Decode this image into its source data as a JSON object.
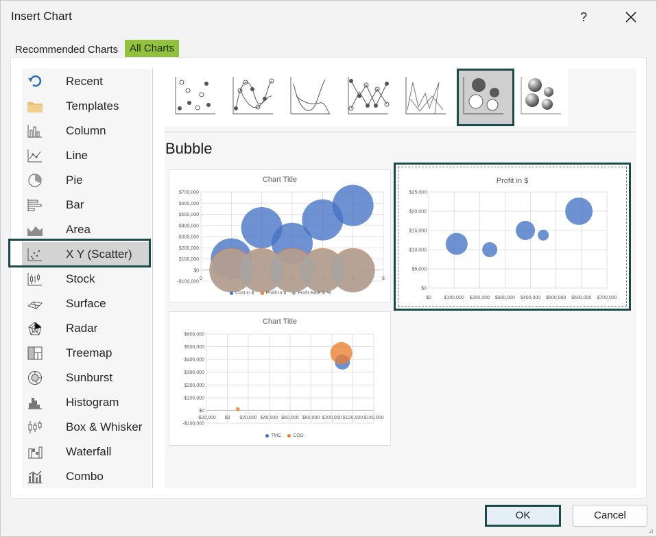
{
  "dialog": {
    "title": "Insert Chart",
    "help_label": "?"
  },
  "tabs": [
    {
      "label": "Recommended Charts",
      "active": false
    },
    {
      "label": "All Charts",
      "active": true,
      "color": "#92c13f"
    }
  ],
  "categories": [
    {
      "label": "Recent",
      "icon": "recent-icon"
    },
    {
      "label": "Templates",
      "icon": "folder-icon"
    },
    {
      "label": "Column",
      "icon": "column-chart-icon"
    },
    {
      "label": "Line",
      "icon": "line-chart-icon"
    },
    {
      "label": "Pie",
      "icon": "pie-chart-icon"
    },
    {
      "label": "Bar",
      "icon": "bar-chart-icon"
    },
    {
      "label": "Area",
      "icon": "area-chart-icon"
    },
    {
      "label": "X Y (Scatter)",
      "icon": "scatter-chart-icon",
      "selected": true
    },
    {
      "label": "Stock",
      "icon": "stock-chart-icon"
    },
    {
      "label": "Surface",
      "icon": "surface-chart-icon"
    },
    {
      "label": "Radar",
      "icon": "radar-chart-icon"
    },
    {
      "label": "Treemap",
      "icon": "treemap-chart-icon"
    },
    {
      "label": "Sunburst",
      "icon": "sunburst-chart-icon"
    },
    {
      "label": "Histogram",
      "icon": "histogram-chart-icon"
    },
    {
      "label": "Box & Whisker",
      "icon": "box-whisker-chart-icon"
    },
    {
      "label": "Waterfall",
      "icon": "waterfall-chart-icon"
    },
    {
      "label": "Combo",
      "icon": "combo-chart-icon"
    }
  ],
  "subtypes": [
    {
      "name": "scatter",
      "icon": "scatter-icon"
    },
    {
      "name": "scatter-smooth-lines-markers",
      "icon": "scatter-smooth-markers-icon"
    },
    {
      "name": "scatter-smooth-lines",
      "icon": "scatter-smooth-icon"
    },
    {
      "name": "scatter-straight-lines-markers",
      "icon": "scatter-straight-markers-icon"
    },
    {
      "name": "scatter-straight-lines",
      "icon": "scatter-straight-icon"
    },
    {
      "name": "bubble",
      "icon": "bubble-icon",
      "selected": true
    },
    {
      "name": "3d-bubble",
      "icon": "bubble-3d-icon"
    }
  ],
  "section_title": "Bubble",
  "chart_data": [
    {
      "type": "scatter",
      "variant": "bubble",
      "title": "Chart Title",
      "x": [
        1,
        2,
        3,
        4,
        5
      ],
      "xlim": [
        0,
        6
      ],
      "ylim": [
        -100000,
        700000
      ],
      "y_ticks": [
        "$700,000",
        "$600,000",
        "$500,000",
        "$400,000",
        "$300,000",
        "$200,000",
        "$100,000",
        "$0",
        "-$100,000"
      ],
      "x_ticks": [
        "0",
        "1",
        "2",
        "3",
        "4",
        "5",
        "6"
      ],
      "series": [
        {
          "name": "Cost in $",
          "color": "#4472c4",
          "values": [
            100000,
            380000,
            240000,
            450000,
            580000
          ],
          "sizes": [
            30,
            30,
            30,
            30,
            30
          ]
        },
        {
          "name": "Profit in $",
          "color": "#ed7d31",
          "values": [
            0,
            0,
            0,
            0,
            0
          ],
          "sizes": [
            32,
            32,
            32,
            32,
            32
          ]
        },
        {
          "name": "Profit Rate in %",
          "color": "#a5a5a5",
          "values": [
            -5000,
            -5000,
            -5000,
            -5000,
            -5000
          ],
          "sizes": [
            32,
            32,
            32,
            32,
            32
          ]
        }
      ],
      "grid": true,
      "legend": "bottom"
    },
    {
      "type": "scatter",
      "variant": "bubble",
      "title": "Profit in $",
      "xlim": [
        0,
        700000
      ],
      "ylim": [
        0,
        25000
      ],
      "y_ticks": [
        "$25,000",
        "$20,000",
        "$15,000",
        "$10,000",
        "$5,000",
        "$0"
      ],
      "x_ticks": [
        "$0",
        "$100,000",
        "$200,000",
        "$300,000",
        "$400,000",
        "$500,000",
        "$600,000",
        "$700,000"
      ],
      "series": [
        {
          "name": "Profit in $",
          "color": "#4472c4",
          "x": [
            110000,
            240000,
            380000,
            450000,
            590000
          ],
          "values": [
            11500,
            10000,
            15000,
            13800,
            20000
          ],
          "sizes": [
            16,
            11,
            14,
            8,
            20
          ]
        }
      ],
      "grid": true,
      "selected": true
    },
    {
      "type": "scatter",
      "variant": "bubble",
      "title": "Chart Title",
      "xlim": [
        -20000,
        140000
      ],
      "ylim": [
        -100000,
        600000
      ],
      "y_ticks": [
        "$600,000",
        "$500,000",
        "$400,000",
        "$300,000",
        "$200,000",
        "$100,000",
        "$0",
        "-$100,000"
      ],
      "x_ticks": [
        "-$20,000",
        "$0",
        "$20,000",
        "$40,000",
        "$60,000",
        "$80,000",
        "$100,000",
        "$120,000",
        "$140,000"
      ],
      "series": [
        {
          "name": "TMC",
          "color": "#4472c4",
          "x": [
            110000
          ],
          "values": [
            380000
          ],
          "sizes": [
            11
          ]
        },
        {
          "name": "COS",
          "color": "#ed7d31",
          "x": [
            10000,
            109000
          ],
          "values": [
            10000,
            450000
          ],
          "sizes": [
            3,
            16
          ]
        }
      ],
      "grid": true,
      "legend": "bottom"
    }
  ],
  "buttons": {
    "ok": "OK",
    "cancel": "Cancel"
  }
}
